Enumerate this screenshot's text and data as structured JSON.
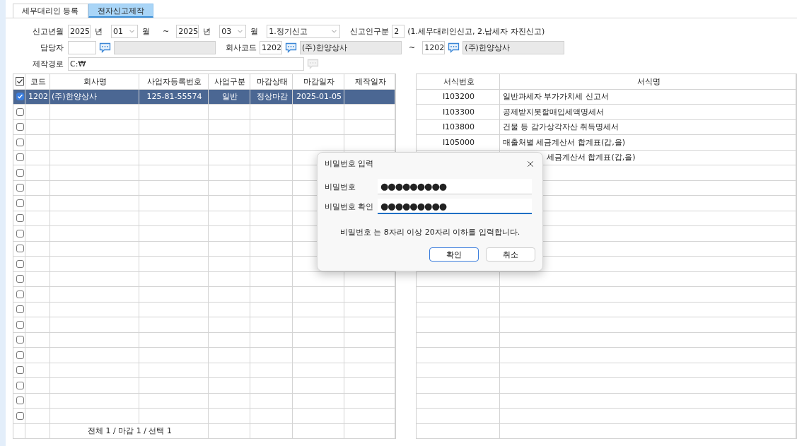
{
  "tabs": [
    {
      "label": "세무대리인 등록",
      "selected": false
    },
    {
      "label": "전자신고제작",
      "selected": true
    }
  ],
  "filter_rows": [
    {
      "items": [
        {
          "kind": "label",
          "text": "신고년월"
        },
        {
          "kind": "number",
          "value": "2025"
        },
        {
          "kind": "unit",
          "text": "년"
        },
        {
          "kind": "month",
          "value": "01"
        },
        {
          "kind": "unit",
          "text": "월"
        },
        {
          "kind": "separator",
          "text": "~"
        },
        {
          "kind": "number",
          "value": "2025"
        },
        {
          "kind": "unit",
          "text": "년"
        },
        {
          "kind": "month",
          "value": "03"
        },
        {
          "kind": "unit",
          "text": "월"
        },
        {
          "kind": "type",
          "value": "1.정기신고"
        },
        {
          "kind": "section",
          "text": "신고인구분"
        },
        {
          "kind": "digit",
          "value": "2"
        },
        {
          "kind": "note",
          "text": "(1.세무대리인신고, 2.납세자 자진신고)"
        }
      ]
    },
    {
      "items": [
        {
          "kind": "label",
          "text": "담당자"
        },
        {
          "kind": "code",
          "disabled": false
        },
        {
          "kind": "lookup",
          "disabled": false
        },
        {
          "kind": "name",
          "disabled": true
        },
        {
          "kind": "section",
          "text": "회사코드"
        },
        {
          "kind": "number",
          "value": "1202"
        },
        {
          "kind": "lookup",
          "disabled": false
        },
        {
          "kind": "name",
          "value": "(주)한양상사",
          "disabled": true
        },
        {
          "kind": "separator",
          "text": "~"
        },
        {
          "kind": "number",
          "value": "1202"
        },
        {
          "kind": "lookup",
          "disabled": false
        },
        {
          "kind": "name",
          "value": "(주)한양상사",
          "disabled": true
        }
      ]
    },
    {
      "items": [
        {
          "kind": "label",
          "text": "제작경로"
        },
        {
          "kind": "path",
          "value": "C:₩"
        },
        {
          "kind": "lookup",
          "disabled": true
        }
      ]
    }
  ],
  "company_table": {
    "select_all": {
      "checked": true
    },
    "columns": [
      "코드",
      "회사명",
      "사업자등록번호",
      "사업구분",
      "마감상태",
      "마감일자",
      "제작일자"
    ],
    "rows": [
      {
        "checked": true,
        "selected": true,
        "cells": [
          "1202",
          "(주)한양상사",
          "125-81-55574",
          "일반",
          "정상마감",
          "2025-01-05"
        ]
      },
      {
        "checked": false,
        "selected": false
      },
      {
        "checked": false,
        "selected": false
      },
      {
        "checked": false,
        "selected": false
      },
      {
        "checked": false,
        "selected": false
      },
      {
        "checked": false,
        "selected": false
      },
      {
        "checked": false,
        "selected": false
      },
      {
        "checked": false,
        "selected": false
      },
      {
        "checked": false,
        "selected": false
      },
      {
        "checked": false,
        "selected": false
      },
      {
        "checked": false,
        "selected": false
      },
      {
        "checked": false,
        "selected": false
      },
      {
        "checked": false,
        "selected": false
      },
      {
        "checked": false,
        "selected": false
      },
      {
        "checked": false,
        "selected": false
      },
      {
        "checked": false,
        "selected": false
      },
      {
        "checked": false,
        "selected": false
      },
      {
        "checked": false,
        "selected": false
      },
      {
        "checked": false,
        "selected": false
      },
      {
        "checked": false,
        "selected": false
      },
      {
        "checked": false,
        "selected": false
      },
      {
        "checked": false,
        "selected": false
      }
    ],
    "footer": "전체 1 / 마감 1 / 선택 1"
  },
  "form_table": {
    "columns": [
      "서식번호",
      "서식명"
    ],
    "rows": [
      {
        "form_no": "I103200",
        "name": "일반과세자 부가가치세 신고서"
      },
      {
        "form_no": "I103300",
        "name": "공제받지못할매입세액명세서"
      },
      {
        "form_no": "I103800",
        "name": "건물 등 감가상각자산 취득명세서"
      },
      {
        "form_no": "I105000",
        "name": "매출처별 세금계산서 합계표(갑,을)"
      },
      {
        "name": "세금계산서 합계표(갑,을)",
        "partly_covered": true
      }
    ]
  },
  "dialog": {
    "title": "비밀번호 입력",
    "fields": [
      {
        "label": "비밀번호",
        "value": "●●●●●●●●●",
        "focused": false
      },
      {
        "label": "비밀번호 확인",
        "value": "●●●●●●●●●",
        "focused": true
      }
    ],
    "message": "비밀번호 는 8자리 이상 20자리 이하를 입력합니다.",
    "buttons": [
      {
        "label": "확인",
        "default": true
      },
      {
        "label": "취소",
        "default": false
      }
    ]
  }
}
